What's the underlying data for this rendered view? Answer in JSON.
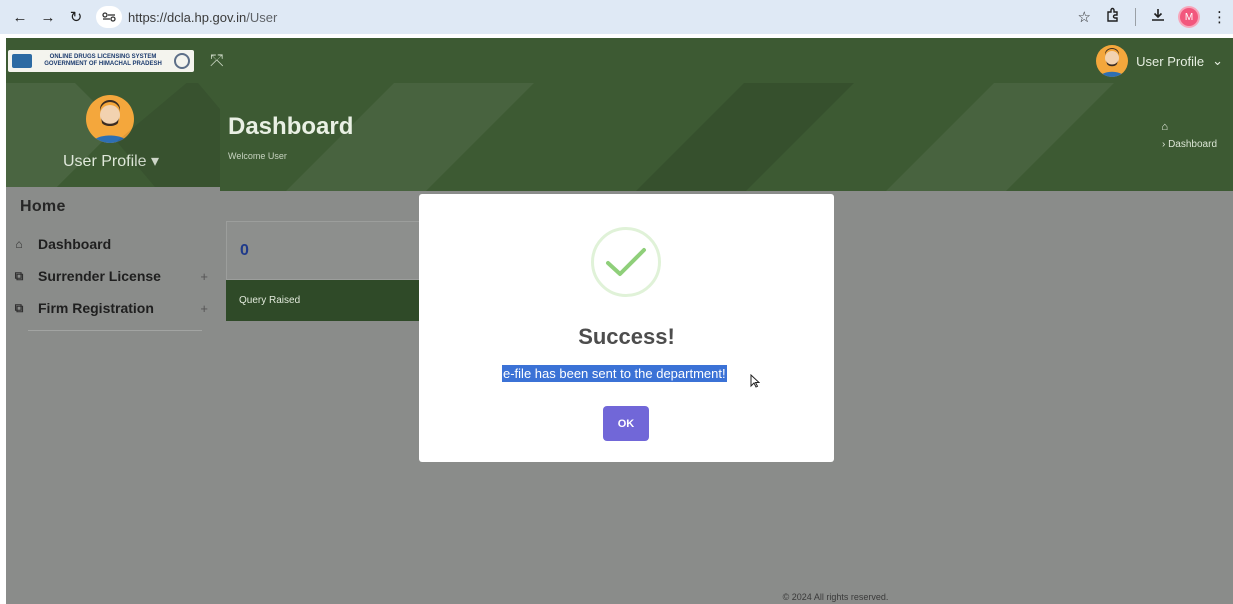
{
  "browser": {
    "url_host": "https://dcla.hp.gov.in",
    "url_path": "/User",
    "profile_initial": "M"
  },
  "topnav": {
    "logo_line1": "ONLINE DRUGS LICENSING SYSTEM",
    "logo_line2": "GOVERNMENT OF HIMACHAL PRADESH",
    "profile_label": "User Profile"
  },
  "sidebar": {
    "user_label": "User Profile",
    "section_heading": "Home",
    "items": [
      {
        "label": "Dashboard",
        "icon": "home-icon",
        "expandable": false
      },
      {
        "label": "Surrender License",
        "icon": "copy-icon",
        "expandable": true
      },
      {
        "label": "Firm Registration",
        "icon": "copy-icon",
        "expandable": true
      }
    ]
  },
  "banner": {
    "title": "Dashboard",
    "subtitle": "Welcome User",
    "breadcrumb": "Dashboard"
  },
  "card": {
    "count": "0",
    "label": "Query Raised"
  },
  "footer": {
    "text": "© 2024 All rights reserved."
  },
  "modal": {
    "title": "Success!",
    "message": "e-file has been sent to the department!",
    "ok_label": "OK"
  },
  "colors": {
    "header_green": "#3d5a33",
    "overlay_grey": "#8a8c8a",
    "ok_button": "#7167d8",
    "selection_blue": "#3b72d6",
    "success_check": "#8fcf7a"
  }
}
